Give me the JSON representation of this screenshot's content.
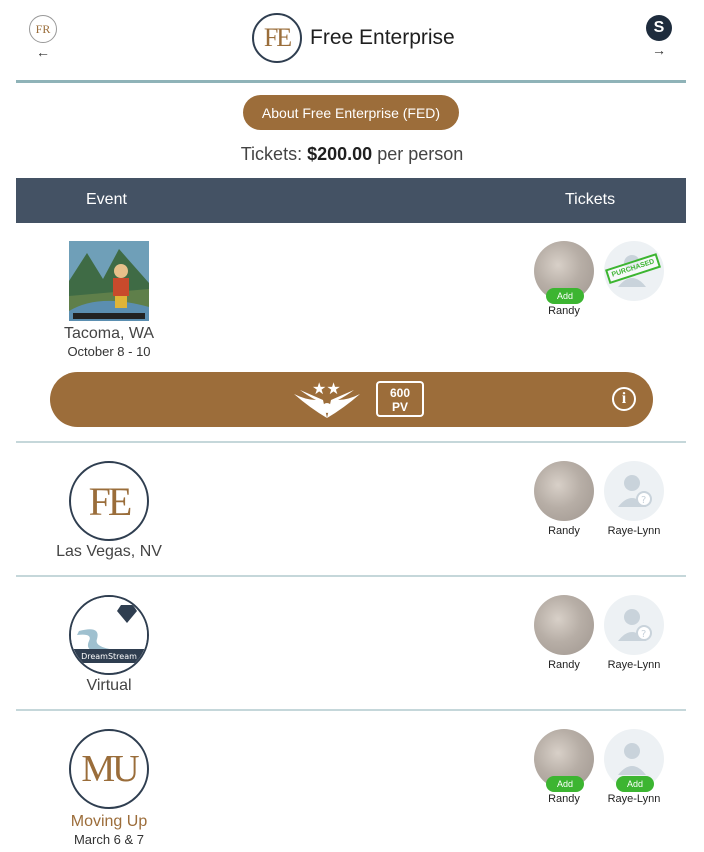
{
  "header": {
    "left_badge": "FR",
    "left_arrow": "←",
    "brand_logo": "FE",
    "brand_title": "Free Enterprise",
    "right_badge": "S",
    "right_arrow": "→"
  },
  "about_button": "About Free Enterprise (FED)",
  "tickets": {
    "label": "Tickets:",
    "price": "$200.00",
    "suffix": "per person"
  },
  "table": {
    "col_event": "Event",
    "col_tickets": "Tickets"
  },
  "events": [
    {
      "city": "Tacoma, WA",
      "date": "October 8 - 10",
      "tickets": [
        {
          "name": "Randy",
          "add_label": "Add"
        },
        {
          "stamp": "PURCHASED"
        }
      ],
      "pv_bar": {
        "pv_value": "600",
        "pv_unit": "PV",
        "info_icon": "i"
      }
    },
    {
      "city": "Las Vegas, NV",
      "logo_text": "FE",
      "tickets": [
        {
          "name": "Randy"
        },
        {
          "name": "Raye-Lynn"
        }
      ]
    },
    {
      "city": "Virtual",
      "logo_text": "DreamStream",
      "tickets": [
        {
          "name": "Randy"
        },
        {
          "name": "Raye-Lynn"
        }
      ]
    },
    {
      "city": "Moving Up",
      "date": "March 6 & 7",
      "logo_text": "MU",
      "tickets": [
        {
          "name": "Randy",
          "add_label": "Add"
        },
        {
          "name": "Raye-Lynn",
          "add_label": "Add"
        }
      ]
    }
  ],
  "colors": {
    "accent": "#9c6d3a",
    "header_bar": "#445264",
    "add_green": "#3cb531",
    "divider": "#c5d7da"
  }
}
